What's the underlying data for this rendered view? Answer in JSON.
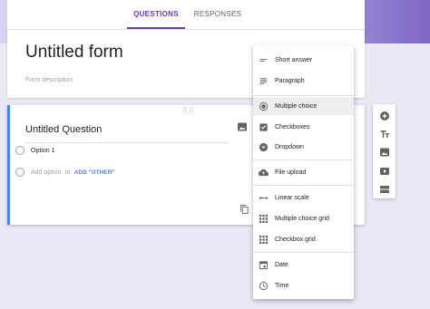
{
  "tabs": [
    {
      "label": "QUESTIONS",
      "active": true
    },
    {
      "label": "RESPONSES",
      "active": false
    }
  ],
  "form": {
    "title": "Untitled form",
    "description_placeholder": "Form description"
  },
  "question": {
    "title": "Untitled Question",
    "options": [
      "Option 1"
    ],
    "add_option": "Add option",
    "or": "or",
    "add_other": "ADD \"OTHER\""
  },
  "type_menu": {
    "items": [
      {
        "label": "Short answer",
        "icon": "short-answer-icon"
      },
      {
        "label": "Paragraph",
        "icon": "paragraph-icon"
      },
      {
        "label": "Multiple choice",
        "icon": "radio-button-icon",
        "selected": true
      },
      {
        "label": "Checkboxes",
        "icon": "checkbox-icon"
      },
      {
        "label": "Dropdown",
        "icon": "dropdown-icon"
      },
      {
        "label": "File upload",
        "icon": "cloud-upload-icon"
      },
      {
        "label": "Linear scale",
        "icon": "linear-scale-icon"
      },
      {
        "label": "Multiple choice grid",
        "icon": "grid-icon"
      },
      {
        "label": "Checkbox grid",
        "icon": "checkbox-grid-icon"
      },
      {
        "label": "Date",
        "icon": "calendar-icon"
      },
      {
        "label": "Time",
        "icon": "clock-icon"
      }
    ]
  },
  "side_toolbar": {
    "icons": [
      "add-circle-icon",
      "title-text-icon",
      "image-icon",
      "video-icon",
      "section-icon"
    ]
  },
  "colors": {
    "accent": "#673ab7",
    "focus": "#4285f4",
    "icon": "#5f6368"
  }
}
